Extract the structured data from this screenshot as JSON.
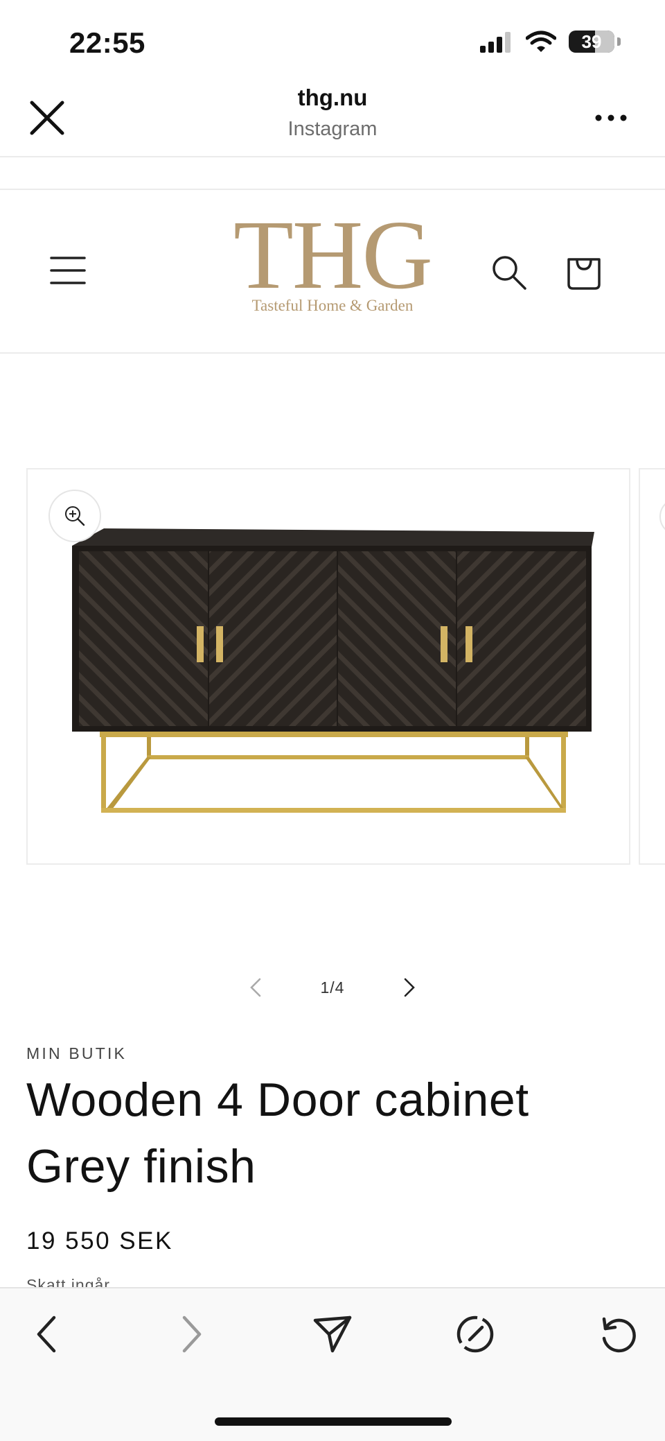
{
  "status_bar": {
    "time": "22:55",
    "battery": "39",
    "icons": [
      "cellular-signal-icon",
      "wifi-icon",
      "battery-icon"
    ]
  },
  "browser": {
    "site": "thg.nu",
    "source": "Instagram",
    "close_icon": "close-icon",
    "more_icon": "more-dots-icon"
  },
  "store_header": {
    "logo_main": "THG",
    "logo_sub": "Tasteful Home & Garden",
    "icons": [
      "menu-icon",
      "search-icon",
      "cart-icon"
    ],
    "brand_color": "#b59a72"
  },
  "gallery": {
    "counter": "1/4",
    "current": 1,
    "total": 4
  },
  "product": {
    "vendor": "MIN BUTIK",
    "title_line1": "Wooden 4 Door cabinet",
    "title_line2": "Grey finish",
    "price": "19 550 SEK",
    "tax_note": "Skatt ingår"
  },
  "bottom_bar": {
    "icons": [
      "back-arrow-icon",
      "forward-arrow-icon",
      "share-icon",
      "compass-icon",
      "reload-icon"
    ]
  }
}
